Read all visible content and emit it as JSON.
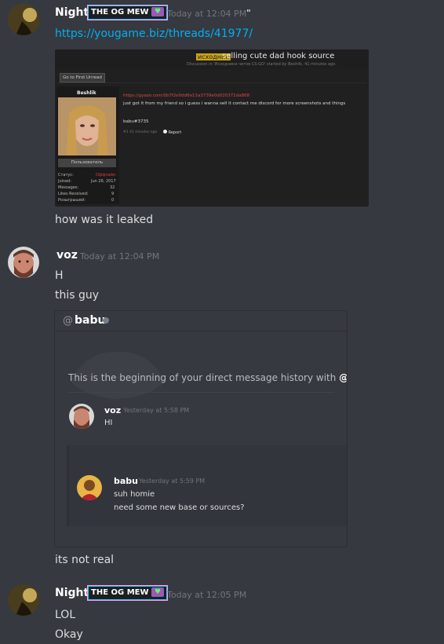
{
  "messages": {
    "m1": {
      "username": "Night",
      "badge": "THE OG MEW",
      "badge_heart": "💜",
      "timestamp": "Today at 12:04 PM",
      "extra": "\"",
      "link": "https://yougame.biz/threads/41977/",
      "text_after": "how was it leaked"
    },
    "m2": {
      "username": "voz",
      "timestamp": "Today at 12:04 PM",
      "lines": [
        "H",
        "this guy"
      ],
      "text_after": "its not real"
    },
    "m3": {
      "username": "Night",
      "badge": "THE OG MEW",
      "badge_heart": "💜",
      "timestamp": "Today at 12:05 PM",
      "lines": [
        "LOL",
        "Okay"
      ]
    }
  },
  "forum": {
    "tag": "исходник",
    "title": "selling cute dad hook source",
    "meta": "Discussion in 'Исходники читов CS:GO' started by Beshlik, 41 minutes ago.",
    "first_unread": "Go to First Unread",
    "poster_name": "Beshlik",
    "poster_role": "Пользователь",
    "stats": [
      {
        "label": "Статус:",
        "value": "Оффлайн"
      },
      {
        "label": "Joined:",
        "value": "Jun 26, 2017"
      },
      {
        "label": "Messages:",
        "value": "32"
      },
      {
        "label": "Likes Received:",
        "value": "9"
      },
      {
        "label": "Розыгрышей:",
        "value": "0"
      }
    ],
    "post_link": "https://gyazo.com/0b7f2e0dd6e11a3739e0d020371da868",
    "post_text": "just got it from my friend so i guess i wanna sell it contact me discord for more screenshots and things",
    "post_contact": "babu#3735",
    "post_footer": "#1   41 minutes ago",
    "report": "Report"
  },
  "dm": {
    "at": "@",
    "name": "babu",
    "intro_pre": "This is the beginning of your direct message history with ",
    "intro_name": "@babu",
    "intro_post": ".",
    "msg1_user": "voz",
    "msg1_time": "Yesterday at 5:58 PM",
    "msg1_text": "HI",
    "msg2_user": "babu",
    "msg2_time": "Yesterday at 5:59 PM",
    "msg2_line1": "suh homie",
    "msg2_line2": "need some new base or sources?"
  }
}
